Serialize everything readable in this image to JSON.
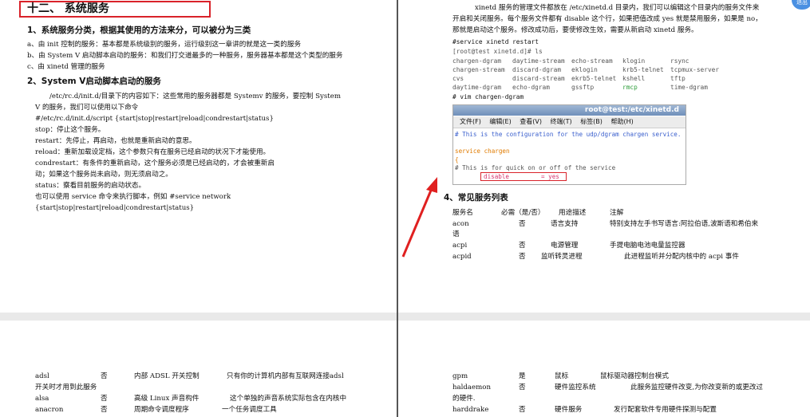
{
  "left_page": {
    "heading": "十二、 系统服务",
    "sec1_title": "1、系统服务分类，根据其使用的方法来分，可以被分为三类",
    "sec1_a": "a、由 init 控制的服务：基本都是系统级别的服务，运行级别这一章讲的就是这一类的服务",
    "sec1_b": "b、由 System V 启动脚本启动的服务：和我们打交道最多的一种服务，服务器基本都是这个类型的服务",
    "sec1_c": "c、由 xinetd 管理的服务",
    "sec2_title": "2、System V启动脚本启动的服务",
    "sec2_l1": "/etc/rc.d/init.d/目录下的内容如下：这些常用的服务器都是 Systemv 的服务，要控制 System",
    "sec2_l2": "V 的服务，我们可以使用以下命令",
    "sec2_l3": "#/etc/rc.d/init.d/script    {start|stop|restart|reload|condrestart|status}",
    "sec2_l4": "stop：停止这个服务。",
    "sec2_l5": "restart：先停止，再启动，也就是重新启动的意思。",
    "sec2_l6": "reload：重新加载设定档，这个参数只有在服务已经启动的状况下才能使用。",
    "sec2_l7": "condrestart：有条件的重新启动，这个服务必须是已经启动的，才会被重新启",
    "sec2_l8": "动；如果这个服务尚未启动，则无须启动之。",
    "sec2_l9": "status：察看目前服务的启动状态。",
    "sec2_l10": "也可以使用 service 命令来执行脚本，例如 #service network",
    "sec2_l11": "{start|stop|restart|reload|condrestart|status}"
  },
  "right_page": {
    "p1": "xinetd 服务的管理文件都放在 /etc/xinetd.d 目录内，我们可以编辑这个目录内的服务文件来",
    "p2": "开启和关闭服务。每个服务文件都有 disable 这个行，如果把值改成 yes 就是禁用服务，如果是 no，",
    "p3": "那就是启动这个服务。修改成功后，要使修改生效，需要从新启动 xinetd 服务。",
    "cmd1": "#service xinetd restart",
    "cmd2": "[root@test xinetd.d]# ls",
    "ls_rows": [
      [
        "chargen-dgram",
        "daytime-stream",
        "echo-stream",
        "klogin",
        "rsync"
      ],
      [
        "chargen-stream",
        "discard-dgram",
        "eklogin",
        "krb5-telnet",
        "tcpmux-server"
      ],
      [
        "cvs",
        "discard-stream",
        "ekrb5-telnet",
        "kshell",
        "tftp"
      ],
      [
        "daytime-dgram",
        "echo-dgram",
        "gssftp",
        "rmcp",
        "time-dgram"
      ]
    ],
    "cmd3": "# vim chargen-dgram",
    "terminal": {
      "title": "root@test:/etc/xinetd.d",
      "menu": [
        "文件(F)",
        "编辑(E)",
        "查看(V)",
        "终端(T)",
        "标签(B)",
        "帮助(H)"
      ],
      "line1": "# This is the configuration for the udp/dgram chargen service.",
      "line2": "service chargen",
      "line3": "{",
      "line4": "# This is for quick on or off of the service",
      "line5_key": "disable",
      "line5_val": "= yes"
    },
    "sec4_title": "4、常见服务列表",
    "table_header": [
      "服务名",
      "必需（是/否）",
      "用途描述",
      "注解"
    ],
    "table_rows": [
      [
        "acon",
        "否",
        "语言支持",
        "特别支持左手书写语言:阿拉伯语,波斯语和希伯来"
      ],
      [
        "acpi",
        "否",
        "电源管理",
        "主要电脑电池电量监控器"
      ],
      [
        "acpid",
        "否",
        "监听转灵进程",
        "此进程监听并分配内核中的 acpi 事件"
      ]
    ],
    "acon_wrap": "语",
    "acpi_note": "手提电脑电池电量监控器"
  },
  "bottom_left": {
    "rows": [
      [
        "adsl",
        "否",
        "内部 ADSL 开关控制",
        "只有你的计算机内部有互联网连接adsl"
      ],
      [
        "alsa",
        "否",
        "高级 Linux 声音构件",
        "这个单独的声音系统实际包含在内核中"
      ],
      [
        "anacron",
        "否",
        "周期命令调度程序",
        "一个任务调度工具"
      ]
    ],
    "adsl_wrap": "开关时才用到此服务"
  },
  "bottom_right": {
    "rows": [
      [
        "gpm",
        "是",
        "鼠标",
        "鼠标驱动器控制台模式"
      ],
      [
        "haldaemon",
        "否",
        "硬件监控系统",
        "此服务监控硬件改变,为你改变新的或更改过"
      ],
      [
        "harddrake",
        "否",
        "硬件服务",
        "发行配套软件专用硬件探测与配置"
      ]
    ],
    "hal_wrap": "的硬件."
  },
  "badge": "退出"
}
